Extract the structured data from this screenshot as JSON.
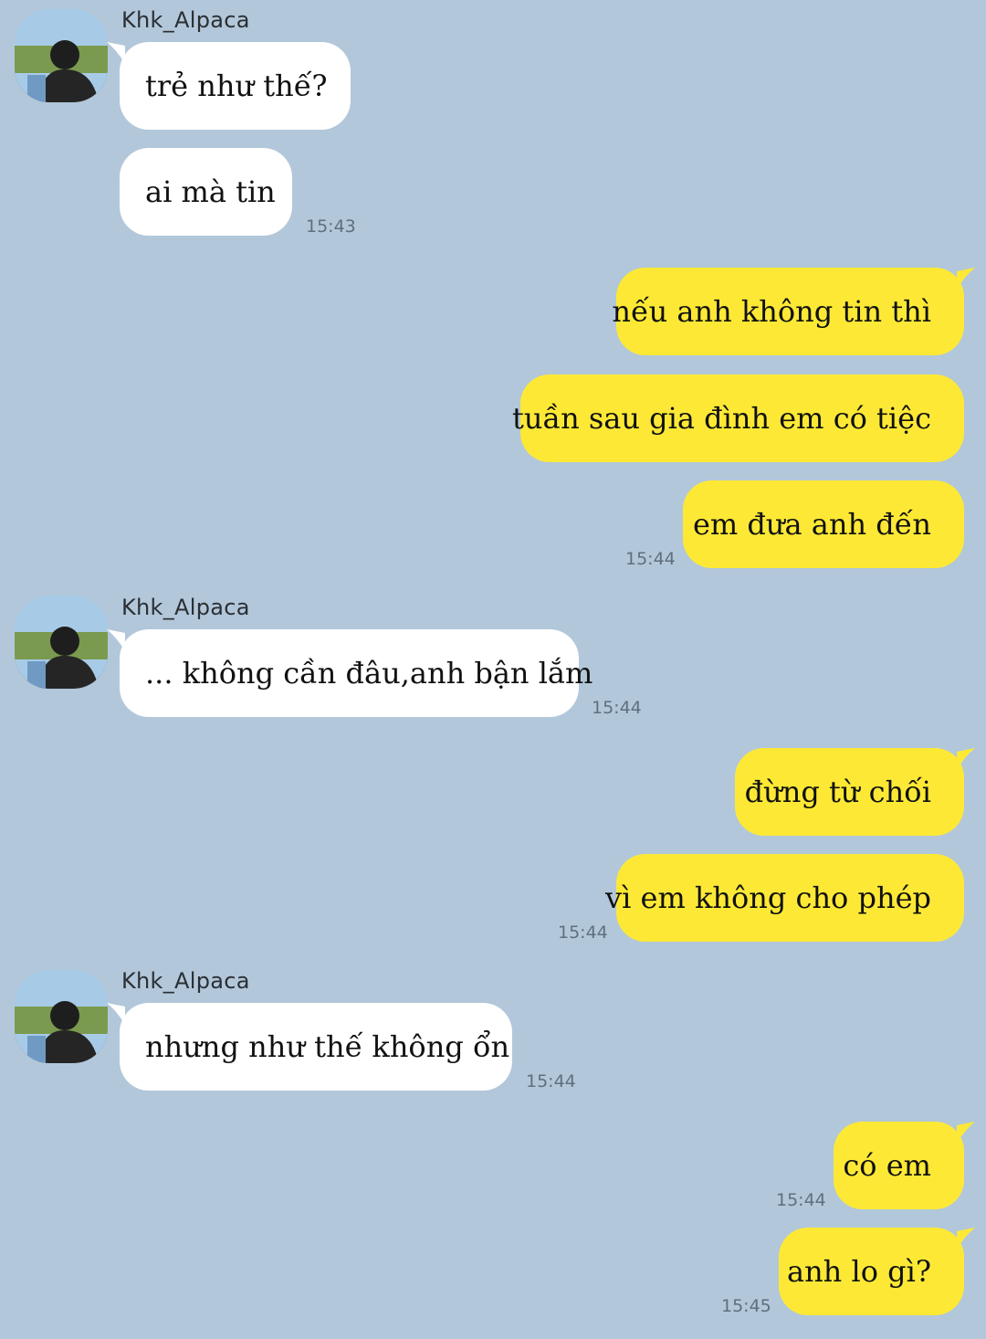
{
  "sender": {
    "name": "Khk_Alpaca"
  },
  "messages": [
    {
      "text": "trẻ như thế?"
    },
    {
      "text": "ai mà tin",
      "time": "15:43"
    },
    {
      "text": "nếu anh không tin thì"
    },
    {
      "text": "tuần sau gia đình em có tiệc"
    },
    {
      "text": "em đưa anh đến",
      "time": "15:44"
    },
    {
      "text": "... không cần đâu,anh bận lắm",
      "time": "15:44"
    },
    {
      "text": "đừng từ chối"
    },
    {
      "text": "vì em không cho phép",
      "time": "15:44"
    },
    {
      "text": "nhưng như thế không ổn",
      "time": "15:44"
    },
    {
      "text": "có em",
      "time": "15:44"
    },
    {
      "text": "anh lo gì?",
      "time": "15:45"
    }
  ],
  "colors": {
    "background": "#b2c7da",
    "incoming_bubble": "#ffffff",
    "outgoing_bubble": "#fde935"
  }
}
